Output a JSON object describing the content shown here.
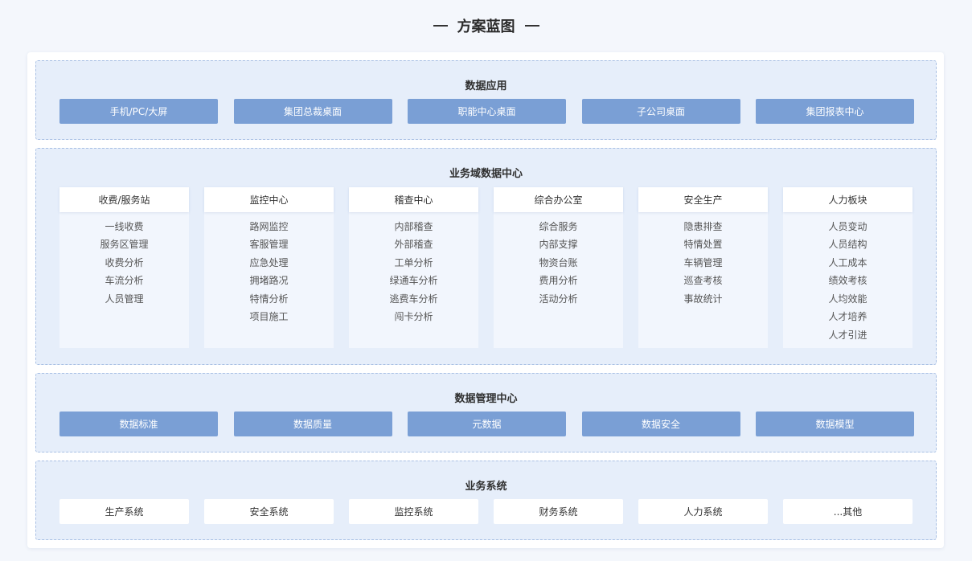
{
  "title": "方案蓝图",
  "layers": {
    "app": {
      "title": "数据应用",
      "items": [
        "手机/PC/大屏",
        "集团总裁桌面",
        "职能中心桌面",
        "子公司桌面",
        "集团报表中心"
      ]
    },
    "domain": {
      "title": "业务域数据中心",
      "columns": [
        {
          "head": "收费/服务站",
          "items": [
            "一线收费",
            "服务区管理",
            "收费分析",
            "车流分析",
            "人员管理"
          ]
        },
        {
          "head": "监控中心",
          "items": [
            "路网监控",
            "客服管理",
            "应急处理",
            "拥堵路况",
            "特情分析",
            "项目施工"
          ]
        },
        {
          "head": "稽查中心",
          "items": [
            "内部稽查",
            "外部稽查",
            "工单分析",
            "绿通车分析",
            "逃费车分析",
            "闯卡分析"
          ]
        },
        {
          "head": "综合办公室",
          "items": [
            "综合服务",
            "内部支撑",
            "物资台账",
            "费用分析",
            "活动分析"
          ]
        },
        {
          "head": "安全生产",
          "items": [
            "隐患排查",
            "特情处置",
            "车辆管理",
            "巡查考核",
            "事故统计"
          ]
        },
        {
          "head": "人力板块",
          "items": [
            "人员变动",
            "人员结构",
            "人工成本",
            "绩效考核",
            "人均效能",
            "人才培养",
            "人才引进"
          ]
        }
      ]
    },
    "mgmt": {
      "title": "数据管理中心",
      "items": [
        "数据标准",
        "数据质量",
        "元数据",
        "数据安全",
        "数据模型"
      ]
    },
    "systems": {
      "title": "业务系统",
      "items": [
        "生产系统",
        "安全系统",
        "监控系统",
        "财务系统",
        "人力系统",
        "...其他"
      ]
    }
  }
}
